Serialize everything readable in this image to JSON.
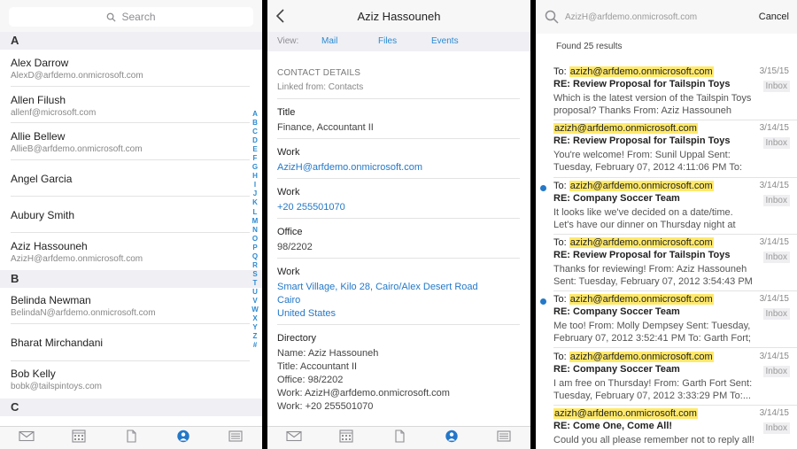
{
  "contacts_panel": {
    "search_placeholder": "Search",
    "sections": [
      {
        "letter": "A",
        "contacts": [
          {
            "name": "Alex Darrow",
            "email": "AlexD@arfdemo.onmicrosoft.com"
          },
          {
            "name": "Allen Filush",
            "email": "allenf@microsoft.com"
          },
          {
            "name": "Allie Bellew",
            "email": "AllieB@arfdemo.onmicrosoft.com"
          },
          {
            "name": "Angel Garcia",
            "email": ""
          },
          {
            "name": "Aubury Smith",
            "email": ""
          },
          {
            "name": "Aziz Hassouneh",
            "email": "AzizH@arfdemo.onmicrosoft.com"
          }
        ]
      },
      {
        "letter": "B",
        "contacts": [
          {
            "name": "Belinda Newman",
            "email": "BelindaN@arfdemo.onmicrosoft.com"
          },
          {
            "name": "Bharat Mirchandani",
            "email": ""
          },
          {
            "name": "Bob Kelly",
            "email": "bobk@tailspintoys.com"
          }
        ]
      },
      {
        "letter": "C",
        "contacts": []
      }
    ],
    "alphabet_index": [
      "A",
      "B",
      "C",
      "D",
      "E",
      "F",
      "G",
      "H",
      "I",
      "J",
      "K",
      "L",
      "M",
      "N",
      "O",
      "P",
      "Q",
      "R",
      "S",
      "T",
      "U",
      "V",
      "W",
      "X",
      "Y",
      "Z",
      "#"
    ]
  },
  "tabbar": {
    "tabs": [
      {
        "icon": "mail-icon",
        "active": false
      },
      {
        "icon": "calendar-icon",
        "active": false
      },
      {
        "icon": "files-icon",
        "active": false
      },
      {
        "icon": "people-icon",
        "active": true
      },
      {
        "icon": "settings-list-icon",
        "active": false
      }
    ],
    "active_color": "#2478c8",
    "inactive_color": "#8e8e93"
  },
  "detail_panel": {
    "title": "Aziz Hassouneh",
    "view_label": "View:",
    "view_links": [
      "Mail",
      "Files",
      "Events"
    ],
    "section_heading": "CONTACT DETAILS",
    "linked_from": "Linked from: Contacts",
    "fields": [
      {
        "label": "Title",
        "lines": [
          "Finance, Accountant II"
        ],
        "link": false
      },
      {
        "label": "Work",
        "lines": [
          "AzizH@arfdemo.onmicrosoft.com"
        ],
        "link": true
      },
      {
        "label": "Work",
        "lines": [
          "+20 255501070"
        ],
        "link": true
      },
      {
        "label": "Office",
        "lines": [
          "98/2202"
        ],
        "link": false
      },
      {
        "label": "Work",
        "lines": [
          "Smart Village, Kilo 28, Cairo/Alex Desert Road",
          "Cairo",
          "United States"
        ],
        "link": true
      },
      {
        "label": "Directory",
        "lines": [
          "Name: Aziz Hassouneh",
          "Title: Accountant II",
          "Office: 98/2202",
          "Work: AzizH@arfdemo.onmicrosoft.com",
          "Work: +20 255501070"
        ],
        "link": false
      }
    ]
  },
  "search_panel": {
    "query": "AzizH@arfdemo.onmicrosoft.com",
    "cancel_label": "Cancel",
    "found_text": "Found 25 results",
    "highlight_color": "#ffe96a",
    "results": [
      {
        "prefix": "To: ",
        "highlight": "azizh@arfdemo.onmicrosoft.com",
        "subject": "RE: Review Proposal for Tailspin Toys",
        "preview": "Which is the latest version of the Tailspin Toys proposal? Thanks From: Aziz Hassouneh Sent:",
        "date": "3/15/15",
        "folder": "Inbox",
        "unread": false
      },
      {
        "prefix": "",
        "highlight": "azizh@arfdemo.onmicrosoft.com",
        "subject": "RE: Review Proposal for Tailspin Toys",
        "preview": "You're welcome! From: Sunil Uppal Sent: Tuesday, February 07, 2012 4:11:06 PM To:",
        "date": "3/14/15",
        "folder": "Inbox",
        "unread": false
      },
      {
        "prefix": "To: ",
        "highlight": "azizh@arfdemo.onmicrosoft.com",
        "subject": "RE: Company Soccer Team",
        "preview": "It looks like we've decided on a date/time. Let's have our dinner on Thursday night at 8pm at...",
        "date": "3/14/15",
        "folder": "Inbox",
        "unread": true
      },
      {
        "prefix": "To: ",
        "highlight": "azizh@arfdemo.onmicrosoft.com",
        "subject": "RE: Review Proposal for Tailspin Toys",
        "preview": "Thanks for reviewing! From: Aziz Hassouneh Sent: Tuesday, February 07, 2012 3:54:43 PM To:",
        "date": "3/14/15",
        "folder": "Inbox",
        "unread": false
      },
      {
        "prefix": "To: ",
        "highlight": "azizh@arfdemo.onmicrosoft.com",
        "subject": "RE: Company Soccer Team",
        "preview": "Me too! From: Molly Dempsey Sent: Tuesday, February 07, 2012 3:52:41 PM To: Garth Fort; S...",
        "date": "3/14/15",
        "folder": "Inbox",
        "unread": true
      },
      {
        "prefix": "To: ",
        "highlight": "azizh@arfdemo.onmicrosoft.com",
        "subject": "RE: Company Soccer Team",
        "preview": "I am free on Thursday! From: Garth Fort Sent: Tuesday, February 07, 2012 3:33:29 PM To:...",
        "date": "3/14/15",
        "folder": "Inbox",
        "unread": false
      },
      {
        "prefix": "",
        "highlight": "azizh@arfdemo.onmicrosoft.com",
        "subject": "RE: Come One, Come All!",
        "preview": "Could you all please remember not to reply all!",
        "date": "3/14/15",
        "folder": "Inbox",
        "unread": false
      }
    ]
  }
}
